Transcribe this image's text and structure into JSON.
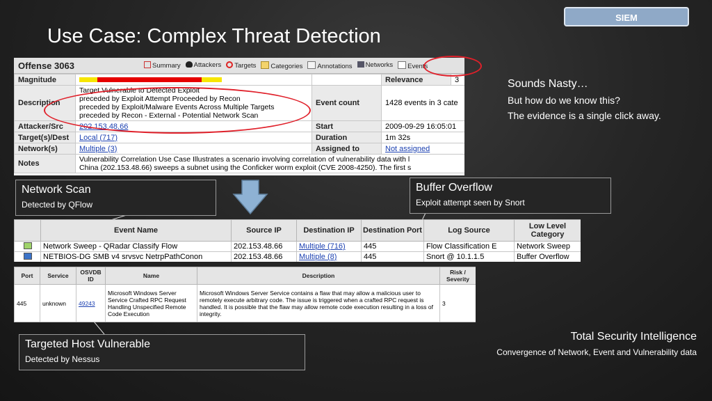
{
  "badge": "SIEM",
  "title": "Use Case: Complex Threat Detection",
  "offense": {
    "title": "Offense 3063",
    "tabs": [
      "Summary",
      "Attackers",
      "Targets",
      "Categories",
      "Annotations",
      "Networks",
      "Events"
    ],
    "magnitude_label": "Magnitude",
    "magnitude_bar": {
      "yellow": "#f7e600",
      "red": "#e60000"
    },
    "relevance_label": "Relevance",
    "relevance_value": "3",
    "description_label": "Description",
    "description_lines": [
      "Target Vulnerable to Detected Exploit",
      "preceded by Exploit Attempt Proceeded by Recon",
      "preceded by Exploit/Malware Events Across Multiple Targets",
      "preceded by Recon - External - Potential Network Scan"
    ],
    "event_count_label": "Event count",
    "event_count_value": "1428 events in 3 cate",
    "attacker_label": "Attacker/Src",
    "attacker_value": "202.153.48.66",
    "start_label": "Start",
    "start_value": "2009-09-29 16:05:01",
    "targets_label": "Target(s)/Dest",
    "targets_value": "Local (717)",
    "duration_label": "Duration",
    "duration_value": "1m 32s",
    "networks_label": "Network(s)",
    "networks_value": "Multiple (3)",
    "assigned_label": "Assigned to",
    "assigned_value": "Not assigned",
    "notes_label": "Notes",
    "notes_lines": [
      "Vulnerability Correlation Use Case Illustrates a scenario involving correlation of vulnerability data with l",
      "China (202.153.48.66) sweeps a subnet using the Conficker worm exploit (CVE 2008-4250). The first s"
    ]
  },
  "callout_network_scan": {
    "heading": "Network Scan",
    "sub": "Detected by QFlow"
  },
  "callout_buffer_overflow": {
    "heading": "Buffer Overflow",
    "sub": "Exploit attempt seen by Snort"
  },
  "callout_targeted_host": {
    "heading": "Targeted Host Vulnerable",
    "sub": "Detected by Nessus"
  },
  "events": {
    "headers": [
      "Event Name",
      "Source IP",
      "Destination IP",
      "Destination Port",
      "Log Source",
      "Low Level Category"
    ],
    "rows": [
      {
        "color": "#9fd36a",
        "name": "Network Sweep  - QRadar Classify Flow",
        "src": "202.153.48.66",
        "dst": "Multiple (716)",
        "port": "445",
        "log": "Flow Classification E",
        "cat": "Network Sweep"
      },
      {
        "color": "#3b73c8",
        "name": "NETBIOS-DG SMB v4 srvsvc NetrpPathConon",
        "src": "202.153.48.66",
        "dst": "Multiple (8)",
        "port": "445",
        "log": "Snort @ 10.1.1.5",
        "cat": "Buffer Overflow"
      }
    ]
  },
  "vuln": {
    "headers": [
      "Port",
      "Service",
      "OSVDB ID",
      "Name",
      "Description",
      "Risk / Severity"
    ],
    "row": {
      "port": "445",
      "service": "unknown",
      "osvdb": "49243",
      "name": "Microsoft Windows Server Service Crafted RPC Request Handling Unspecified Remote Code Execution",
      "description": "Microsoft Windows Server Service contains a flaw that may allow a malicious user to remotely execute arbitrary code. The issue is triggered when a crafted RPC request is handled. It is possible that the flaw may allow remote code execution resulting in a loss of integrity.",
      "risk": "3"
    }
  },
  "sounds": {
    "heading": "Sounds Nasty…",
    "line1": "But how do we know this?",
    "line2": "The evidence is a single click away."
  },
  "total": {
    "heading": "Total Security Intelligence",
    "sub": "Convergence of Network, Event and Vulnerability data"
  }
}
